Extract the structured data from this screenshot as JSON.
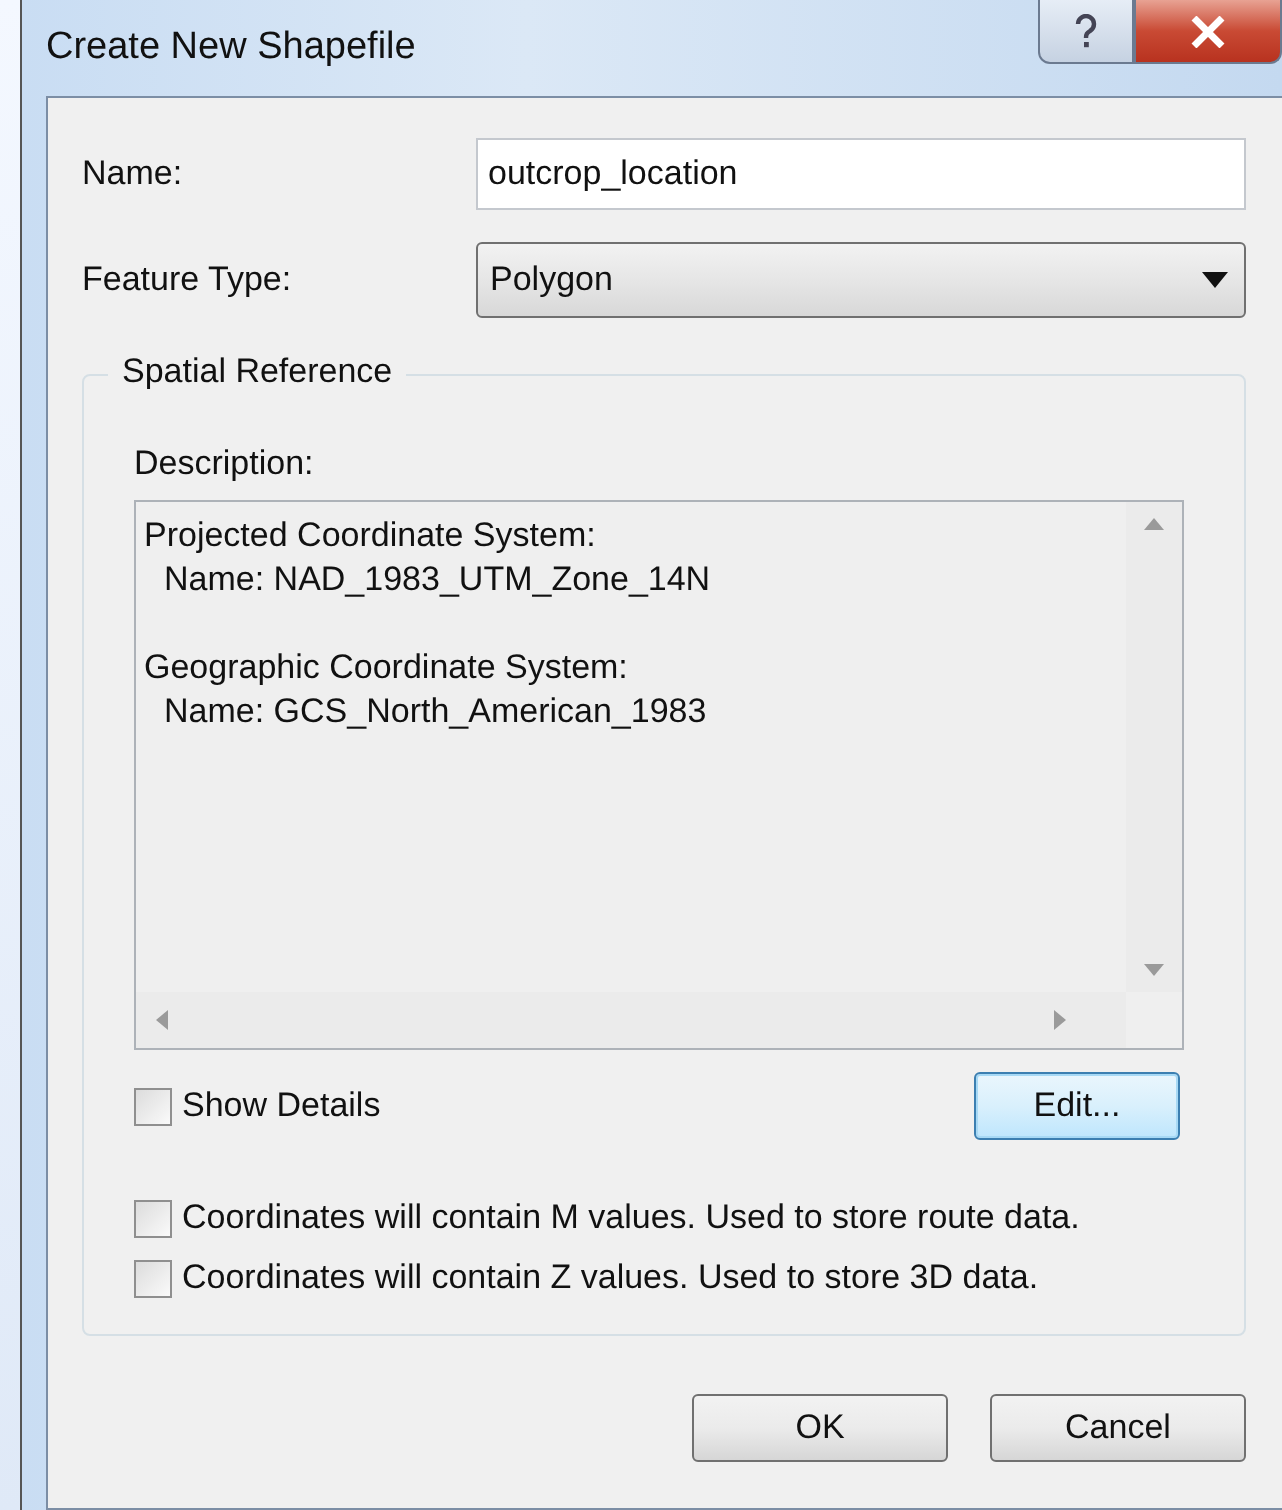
{
  "window": {
    "title": "Create New Shapefile"
  },
  "name_field": {
    "label": "Name:",
    "value": "outcrop_location"
  },
  "feature_type": {
    "label": "Feature Type:",
    "value": "Polygon"
  },
  "spatial_reference": {
    "title": "Spatial Reference",
    "description_label": "Description:",
    "description": [
      {
        "heading": "Projected Coordinate System:",
        "detail": "Name: NAD_1983_UTM_Zone_14N"
      },
      {
        "heading": "Geographic Coordinate System:",
        "detail": "Name: GCS_North_American_1983"
      }
    ],
    "show_details": {
      "label": "Show Details",
      "checked": false
    },
    "edit_button": "Edit...",
    "options": [
      {
        "label": "Coordinates will contain M values. Used to store route data.",
        "checked": false
      },
      {
        "label": "Coordinates will contain Z values. Used to store 3D data.",
        "checked": false
      }
    ]
  },
  "buttons": [
    "OK",
    "Cancel"
  ]
}
